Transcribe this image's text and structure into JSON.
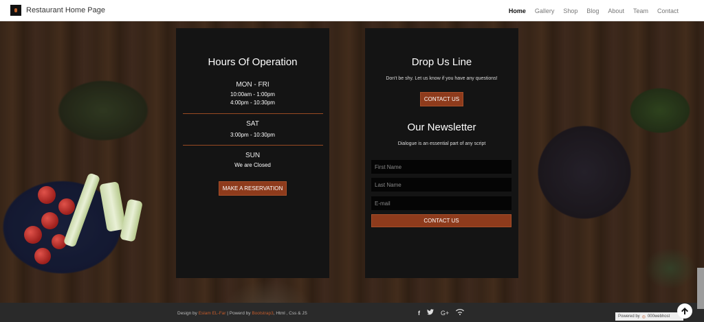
{
  "header": {
    "brand": "Restaurant Home Page",
    "nav": [
      "Home",
      "Gallery",
      "Shop",
      "Blog",
      "About",
      "Team",
      "Contact"
    ],
    "active": "Home"
  },
  "hours": {
    "title": "Hours Of Operation",
    "blocks": [
      {
        "day": "MON - FRI",
        "lines": [
          "10:00am - 1:00pm",
          "4:00pm - 10:30pm"
        ]
      },
      {
        "day": "SAT",
        "lines": [
          "3:00pm - 10:30pm"
        ]
      },
      {
        "day": "SUN",
        "lines": [
          "We are Closed"
        ]
      }
    ],
    "reservation_label": "MAKE A RESERVATION"
  },
  "contact": {
    "title": "Drop Us Line",
    "subtitle": "Don't be shy. Let us know if you have any questions!",
    "button_label": "CONTACT US"
  },
  "newsletter": {
    "title": "Our Newsletter",
    "subtitle": "Dialogue is an essential part of any script",
    "first_name_placeholder": "First Name",
    "last_name_placeholder": "Last Name",
    "email_placeholder": "E-mail",
    "submit_label": "CONTACT US"
  },
  "footer": {
    "design_by_prefix": "Design by",
    "designer": "Eslam EL-Far",
    "separator": "|",
    "powered_prefix": "Powerd by",
    "framework": "Bootstrap3",
    "rest": ", Html , Css & JS",
    "host_badge_prefix": "Powered by",
    "host_badge_name": "000webhost"
  },
  "icons": {
    "facebook": "f",
    "twitter": "🐦",
    "googleplus": "G+",
    "wifi": "≈"
  },
  "colors": {
    "accent": "#8e3b1c",
    "panel": "#141414",
    "link": "#c45b2a"
  }
}
